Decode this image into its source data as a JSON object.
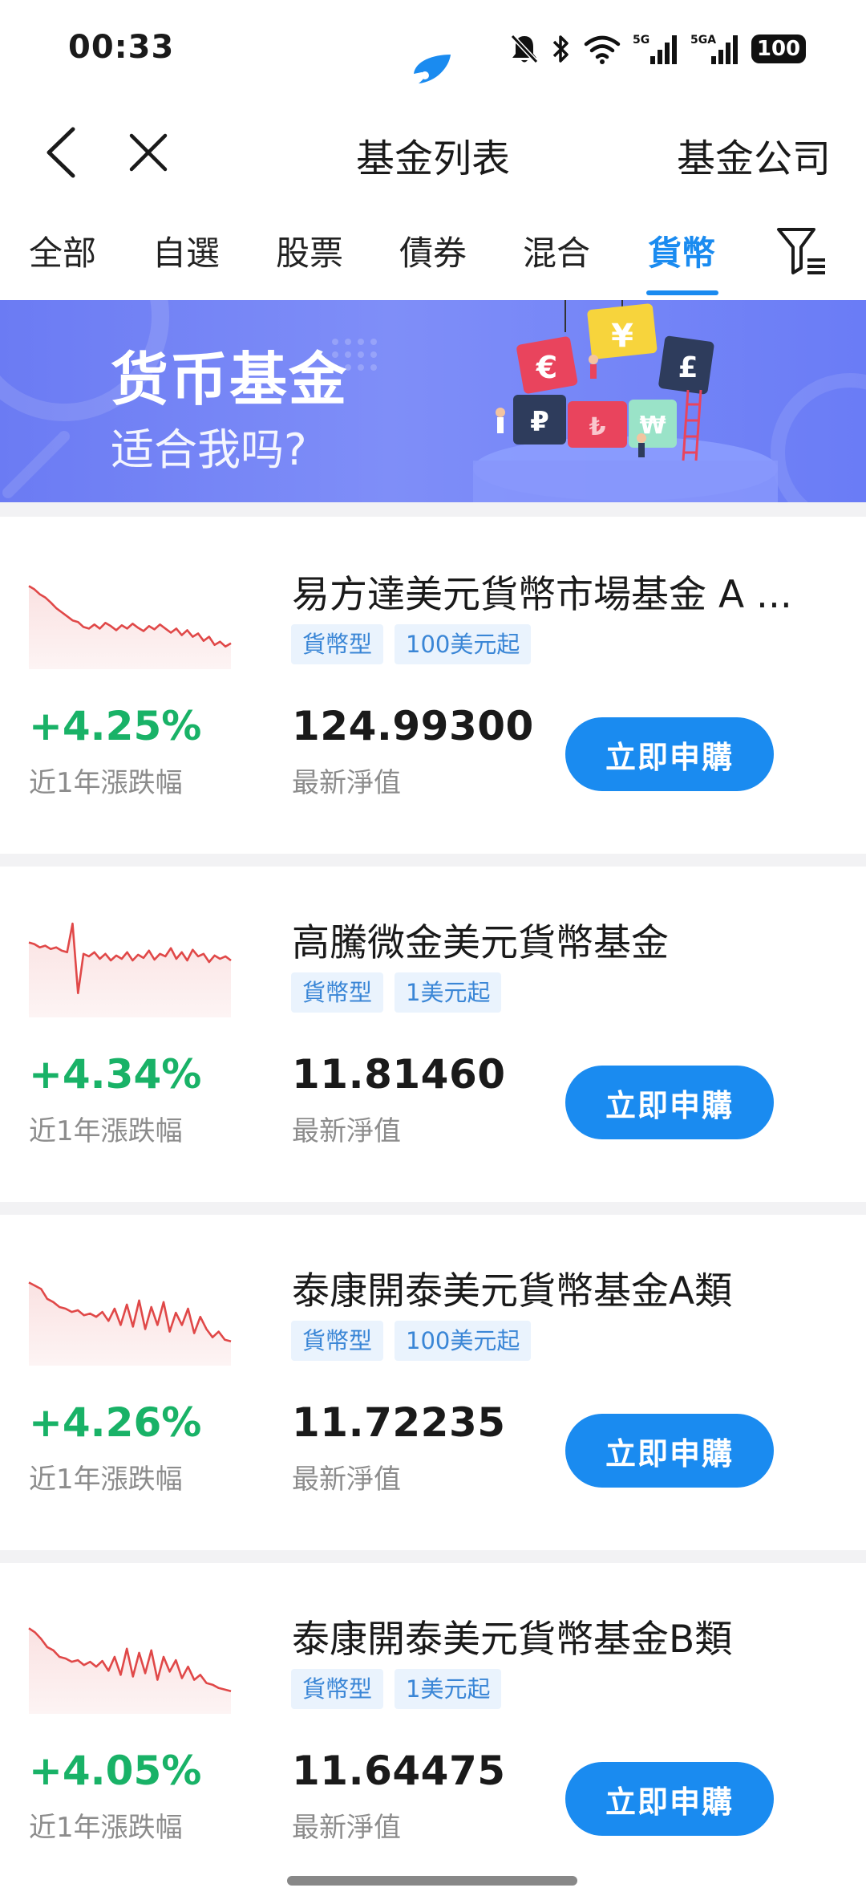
{
  "status_bar": {
    "time": "00:33",
    "network1": "5G",
    "network2": "5GA",
    "battery": "100"
  },
  "nav": {
    "title": "基金列表",
    "right_link": "基金公司"
  },
  "tabs": [
    {
      "label": "全部",
      "active": false
    },
    {
      "label": "自選",
      "active": false
    },
    {
      "label": "股票",
      "active": false
    },
    {
      "label": "債券",
      "active": false
    },
    {
      "label": "混合",
      "active": false
    },
    {
      "label": "貨幣",
      "active": true
    }
  ],
  "banner": {
    "title": "货币基金",
    "subtitle": "适合我吗?",
    "puzzle_symbols": [
      "€",
      "¥",
      "£",
      "₽",
      "₺",
      "₩"
    ]
  },
  "funds": [
    {
      "name": "易方達美元貨幣市場基金 A ...",
      "tags": [
        "貨幣型",
        "100美元起"
      ],
      "return": "+4.25%",
      "return_label": "近1年漲跌幅",
      "nav": "124.99300",
      "nav_label": "最新淨值",
      "button": "立即申購",
      "sparkline": [
        0.82,
        0.78,
        0.72,
        0.68,
        0.62,
        0.55,
        0.5,
        0.45,
        0.4,
        0.38,
        0.32,
        0.3,
        0.35,
        0.3,
        0.37,
        0.33,
        0.28,
        0.34,
        0.3,
        0.36,
        0.31,
        0.27,
        0.33,
        0.29,
        0.35,
        0.3,
        0.25,
        0.3,
        0.22,
        0.28,
        0.2,
        0.24,
        0.15,
        0.2,
        0.1,
        0.14,
        0.08,
        0.12
      ]
    },
    {
      "name": "高騰微金美元貨幣基金",
      "tags": [
        "貨幣型",
        "1美元起"
      ],
      "return": "+4.34%",
      "return_label": "近1年漲跌幅",
      "nav": "11.81460",
      "nav_label": "最新淨值",
      "button": "立即申購",
      "sparkline": [
        0.72,
        0.7,
        0.66,
        0.68,
        0.64,
        0.66,
        0.62,
        0.6,
        0.95,
        0.1,
        0.58,
        0.55,
        0.6,
        0.52,
        0.58,
        0.5,
        0.56,
        0.52,
        0.6,
        0.5,
        0.57,
        0.53,
        0.62,
        0.51,
        0.58,
        0.55,
        0.65,
        0.52,
        0.6,
        0.5,
        0.63,
        0.55,
        0.58,
        0.48,
        0.56,
        0.52,
        0.55,
        0.5
      ]
    },
    {
      "name": "泰康開泰美元貨幣基金A類",
      "tags": [
        "貨幣型",
        "100美元起"
      ],
      "return": "+4.26%",
      "return_label": "近1年漲跌幅",
      "nav": "11.72235",
      "nav_label": "最新淨值",
      "button": "立即申購",
      "sparkline": [
        0.82,
        0.78,
        0.74,
        0.62,
        0.58,
        0.52,
        0.5,
        0.46,
        0.48,
        0.42,
        0.44,
        0.4,
        0.46,
        0.35,
        0.5,
        0.3,
        0.55,
        0.28,
        0.6,
        0.25,
        0.52,
        0.3,
        0.58,
        0.22,
        0.45,
        0.3,
        0.5,
        0.2,
        0.4,
        0.25,
        0.15,
        0.22,
        0.12,
        0.1
      ]
    },
    {
      "name": "泰康開泰美元貨幣基金B類",
      "tags": [
        "貨幣型",
        "1美元起"
      ],
      "return": "+4.05%",
      "return_label": "近1年漲跌幅",
      "nav": "11.64475",
      "nav_label": "最新淨值",
      "button": "立即申購",
      "sparkline": [
        0.85,
        0.8,
        0.72,
        0.62,
        0.58,
        0.5,
        0.48,
        0.44,
        0.46,
        0.4,
        0.44,
        0.38,
        0.45,
        0.33,
        0.5,
        0.28,
        0.6,
        0.26,
        0.55,
        0.3,
        0.58,
        0.22,
        0.5,
        0.32,
        0.46,
        0.24,
        0.38,
        0.22,
        0.28,
        0.18,
        0.16,
        0.12,
        0.1,
        0.08
      ]
    }
  ],
  "colors": {
    "accent": "#1a8bf0",
    "up": "#19b267",
    "spark": "#e04848",
    "banner": "#7181f5"
  }
}
